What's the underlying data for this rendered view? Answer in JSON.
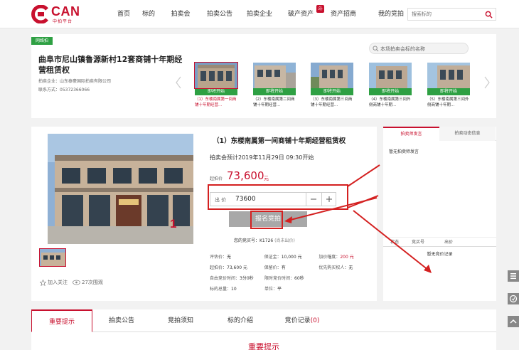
{
  "header": {
    "logo_text": "CAN",
    "logo_sub": "中拍平台",
    "nav": [
      "首页",
      "标的",
      "拍卖会",
      "拍卖公告",
      "拍卖企业",
      "破产资产",
      "资产招商",
      "我的竞拍"
    ],
    "nav_badge": "斗",
    "search_placeholder": "搜索标的"
  },
  "project": {
    "status": "网络拍",
    "title": "曲阜市尼山镇鲁源新村12套商铺十年期经营租赁权",
    "company_label": "拍卖企业：",
    "company": "山东泰豪国际拍卖有限公司",
    "phone_label": "联系方式：",
    "phone": "05372366066",
    "search_placeholder": "本场拍卖会标的名称"
  },
  "lots": [
    {
      "label": "即将开始",
      "caption": "（1）东楼南属第一间商铺十年期经营...",
      "active": true
    },
    {
      "label": "即将开始",
      "caption": "（2）东楼南属第二间商铺十年期经营...",
      "active": false
    },
    {
      "label": "即将开始",
      "caption": "（3）东楼南属第三间商铺十年期经营...",
      "active": false
    },
    {
      "label": "即将开始",
      "caption": "（4）东楼南属第三间外侧商铺十年期...",
      "active": false
    },
    {
      "label": "即将开始",
      "caption": "（5）东楼南属第三间外侧商铺十年期...",
      "active": false
    }
  ],
  "detail": {
    "lot_title": "（1）东楼南属第一间商铺十年期经营租赁权",
    "start_time": "拍卖会预计2019年11月29日  09:30开始",
    "start_price_label": "起拍价",
    "start_price": "73,600",
    "start_price_unit": "元",
    "bid_label": "出 价",
    "bid_value": "73600",
    "bid_button": "报名竞拍",
    "bidder_no": "您的竞买号：K1726",
    "bidder_note": "(尚未出价)",
    "follow": "加入关注",
    "views": "27次围观",
    "info": [
      [
        {
          "k": "评估价：",
          "v": "无"
        },
        {
          "k": "保证金：",
          "v": "10,000 元"
        },
        {
          "k": "加价幅度：",
          "v": "200 元",
          "red": true
        }
      ],
      [
        {
          "k": "起拍价：",
          "v": "73,600 元"
        },
        {
          "k": "保留价：",
          "v": "有"
        },
        {
          "k": "优先购买权人：",
          "v": "无"
        }
      ],
      [
        {
          "k": "自由竞价时间：",
          "v": "3分0秒"
        },
        {
          "k": "限时竞价时间：",
          "v": "60秒"
        }
      ],
      [
        {
          "k": "标的总量：",
          "v": "10"
        },
        {
          "k": "单位：",
          "v": "平"
        }
      ]
    ]
  },
  "right_panel": {
    "tabs": [
      "拍卖师发言",
      "拍卖动态信息"
    ],
    "message": "暂无拍卖师发言",
    "columns": [
      "状态",
      "竞买号",
      "出价"
    ],
    "empty": "暂无竞价记录"
  },
  "bottom_tabs": {
    "tabs": [
      "重要提示",
      "拍卖公告",
      "竞拍须知",
      "标的介绍",
      "竞价记录"
    ],
    "record_count": "(0)",
    "section_title": "重要提示"
  },
  "annotation": {
    "number": "1",
    "color": "#c8102e"
  }
}
